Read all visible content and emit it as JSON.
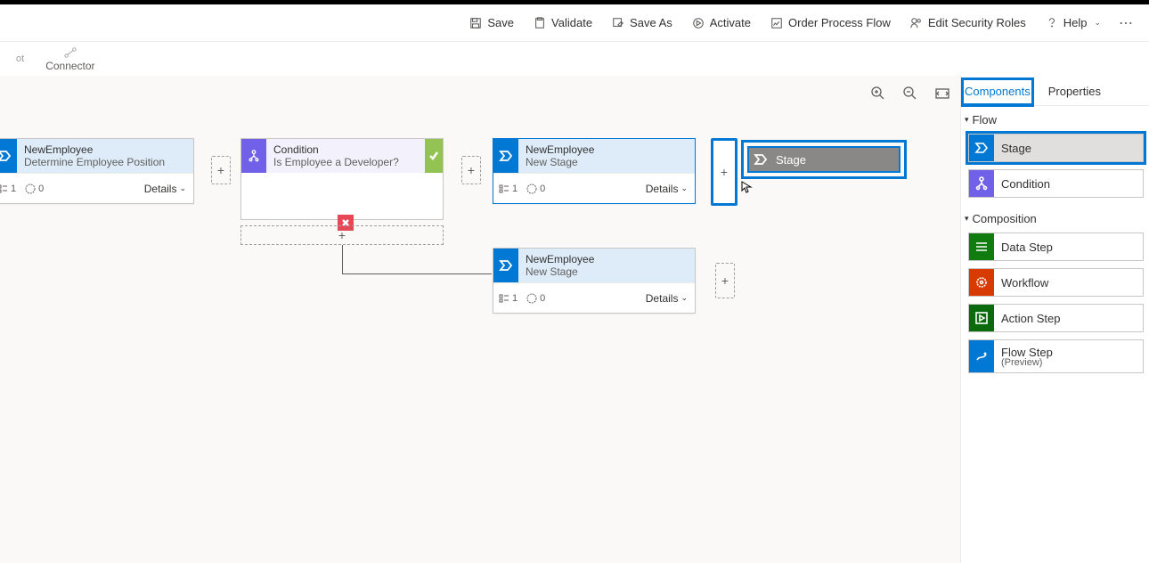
{
  "commands": {
    "save": "Save",
    "validate": "Validate",
    "saveAs": "Save As",
    "activate": "Activate",
    "processName": "Order Process Flow",
    "editSecurity": "Edit Security Roles",
    "help": "Help"
  },
  "toolbar": {
    "connector": "Connector"
  },
  "canvas": {
    "stage1": {
      "entity": "NewEmployee",
      "title": "Determine Employee Position",
      "count": "1",
      "duration": "0",
      "details": "Details"
    },
    "cond": {
      "label": "Condition",
      "question": "Is Employee a Developer?"
    },
    "stage2a": {
      "entity": "NewEmployee",
      "title": "New Stage",
      "count": "1",
      "duration": "0",
      "details": "Details"
    },
    "stage2b": {
      "entity": "NewEmployee",
      "title": "New Stage",
      "count": "1",
      "duration": "0",
      "details": "Details"
    },
    "ghostLabel": "Stage"
  },
  "sidebar": {
    "tabs": {
      "components": "Components",
      "properties": "Properties"
    },
    "sections": {
      "flow": "Flow",
      "composition": "Composition"
    },
    "items": {
      "stage": "Stage",
      "condition": "Condition",
      "dataStep": "Data Step",
      "workflow": "Workflow",
      "actionStep": "Action Step",
      "flowStep": "Flow Step",
      "flowStepSub": "(Preview)"
    }
  }
}
